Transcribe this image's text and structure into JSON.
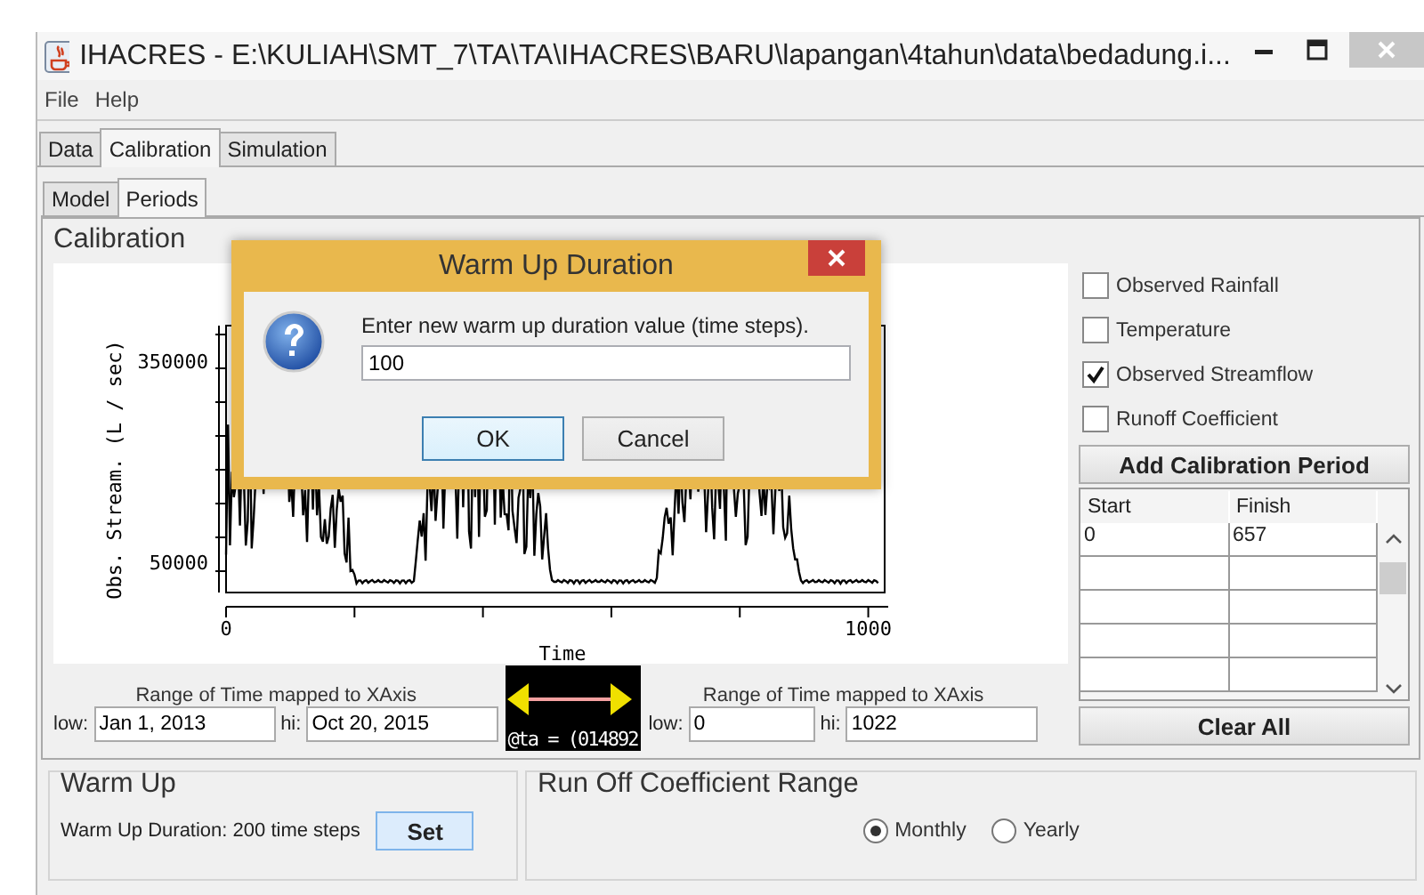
{
  "window": {
    "title": "IHACRES - E:\\KULIAH\\SMT_7\\TA\\TA\\IHACRES\\BARU\\lapangan\\4tahun\\data\\bedadung.i..."
  },
  "menu": [
    "File",
    "Help"
  ],
  "tabs": [
    {
      "label": "Data",
      "selected": false
    },
    {
      "label": "Calibration",
      "selected": true
    },
    {
      "label": "Simulation",
      "selected": false
    }
  ],
  "subtabs": [
    {
      "label": "Model",
      "selected": false
    },
    {
      "label": "Periods",
      "selected": true
    }
  ],
  "calibration": {
    "title": "Calibration",
    "plot": {
      "ylabel": "Obs. Stream. (L / sec)",
      "xlabel": "Time",
      "y_ticks": [
        "350000",
        "50000"
      ],
      "x_ticks": [
        "0",
        "1000"
      ]
    },
    "series_options": [
      {
        "label": "Observed Rainfall",
        "checked": false
      },
      {
        "label": "Temperature",
        "checked": false
      },
      {
        "label": "Observed Streamflow",
        "checked": true
      },
      {
        "label": "Runoff Coefficient",
        "checked": false
      }
    ],
    "add_button": "Add Calibration Period",
    "table": {
      "columns": [
        "Start",
        "Finish"
      ],
      "rows": [
        [
          "0",
          "657"
        ]
      ]
    },
    "clear_button": "Clear All",
    "range_left": {
      "caption": "Range of Time mapped to XAxis",
      "low_label": "low:",
      "low": "Jan 1, 2013",
      "hi_label": "hi:",
      "hi": "Oct 20, 2015"
    },
    "navigator": {
      "text": "@ta = (014892"
    },
    "range_right": {
      "caption": "Range of Time mapped to XAxis",
      "low_label": "low:",
      "low": "0",
      "hi_label": "hi:",
      "hi": "1022"
    }
  },
  "warm_up": {
    "title": "Warm Up",
    "text": "Warm Up Duration: 200 time steps",
    "button": "Set"
  },
  "runoff": {
    "title": "Run Off Coefficient Range",
    "options": [
      {
        "label": "Monthly",
        "selected": true
      },
      {
        "label": "Yearly",
        "selected": false
      }
    ]
  },
  "dialog": {
    "title": "Warm Up Duration",
    "message": "Enter new warm up duration value (time steps).",
    "value": "100",
    "buttons": [
      "OK",
      "Cancel"
    ]
  }
}
